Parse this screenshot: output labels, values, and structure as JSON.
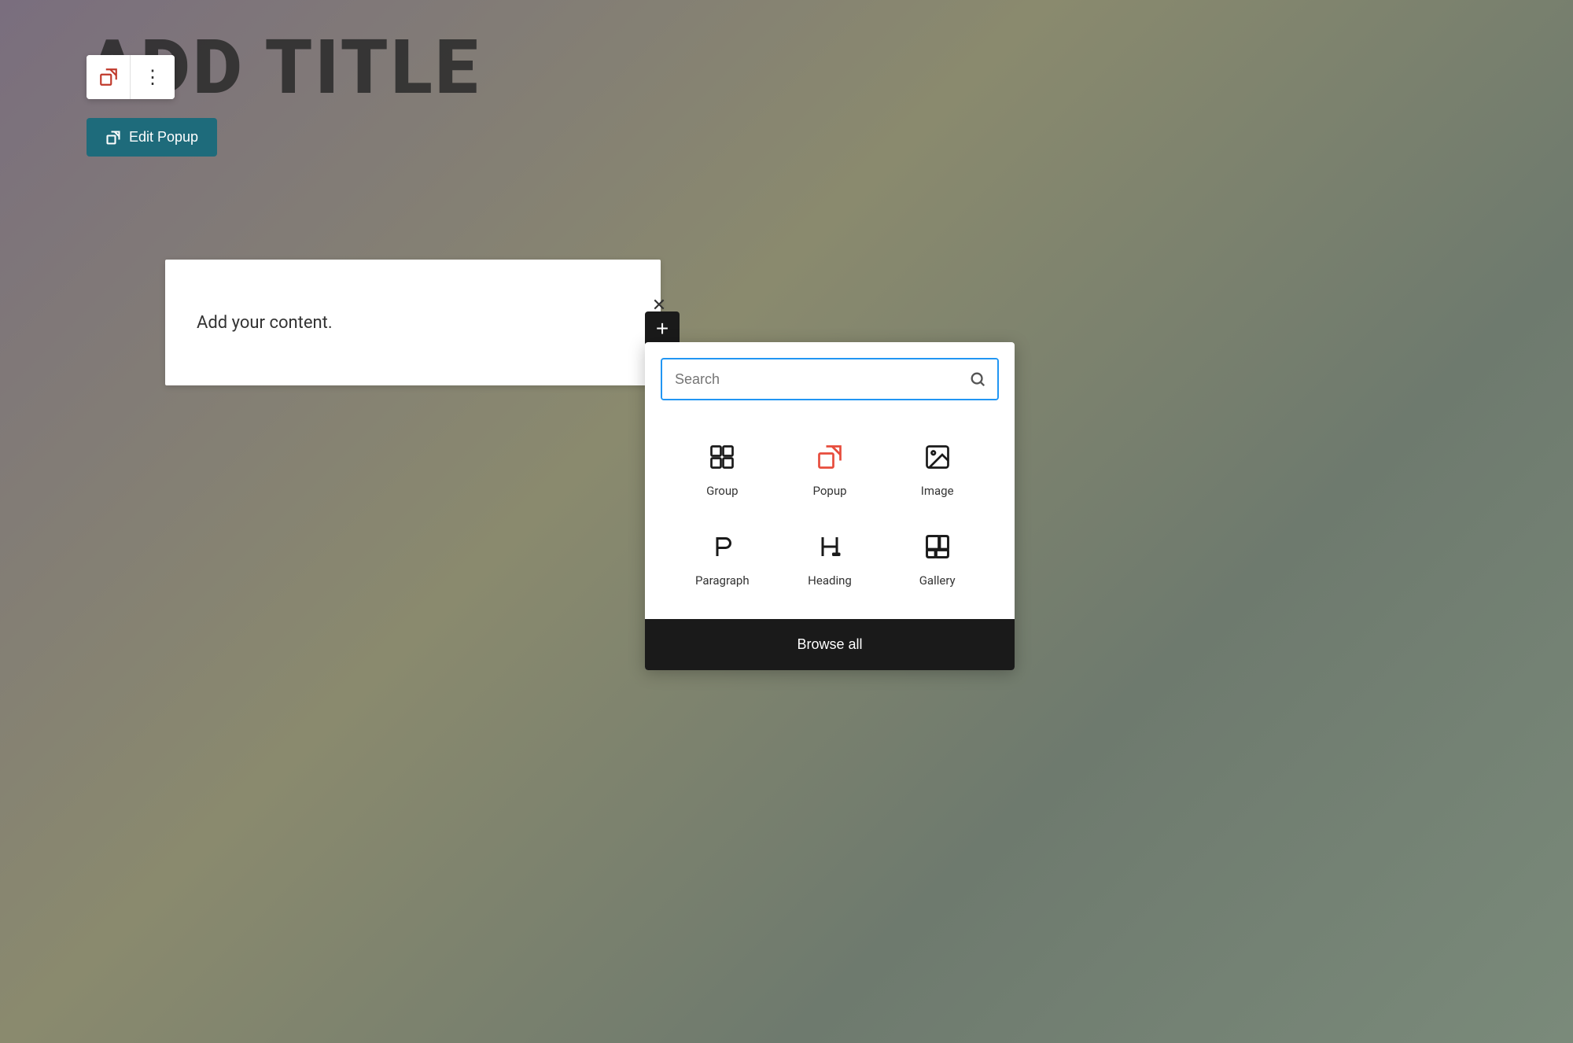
{
  "page": {
    "title": "ADD TITLE",
    "background": "gradient"
  },
  "toolbar": {
    "popup_icon": "↗",
    "more_icon": "⋮"
  },
  "edit_popup_button": {
    "label": "Edit Popup",
    "icon": "↗"
  },
  "content_block": {
    "placeholder": "Add your content."
  },
  "block_inserter": {
    "search_placeholder": "Search",
    "items": [
      {
        "id": "group",
        "label": "Group",
        "icon": "group"
      },
      {
        "id": "popup",
        "label": "Popup",
        "icon": "popup"
      },
      {
        "id": "image",
        "label": "Image",
        "icon": "image"
      },
      {
        "id": "paragraph",
        "label": "Paragraph",
        "icon": "paragraph"
      },
      {
        "id": "heading",
        "label": "Heading",
        "icon": "heading"
      },
      {
        "id": "gallery",
        "label": "Gallery",
        "icon": "gallery"
      }
    ],
    "browse_all_label": "Browse all"
  }
}
